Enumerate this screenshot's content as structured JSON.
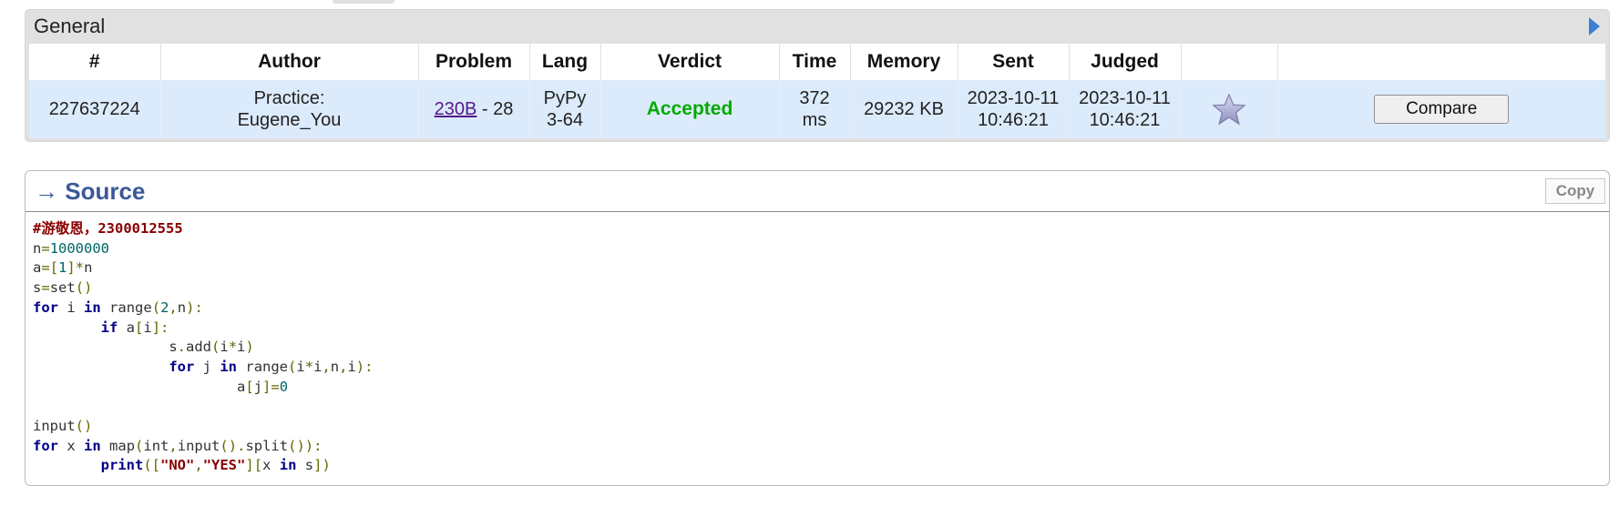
{
  "general": {
    "title": "General",
    "headers": [
      "#",
      "Author",
      "Problem",
      "Lang",
      "Verdict",
      "Time",
      "Memory",
      "Sent",
      "Judged",
      "",
      ""
    ],
    "row": {
      "id": "227637224",
      "author_line1": "Practice:",
      "author_line2": "Eugene_You",
      "problem_link": "230B",
      "problem_suffix": " - 28",
      "lang_line1": "PyPy",
      "lang_line2": "3-64",
      "verdict": "Accepted",
      "time_line1": "372",
      "time_line2": "ms",
      "memory": "29232 KB",
      "sent_date": "2023-10-11",
      "sent_time": "10:46:21",
      "judged_date": "2023-10-11",
      "judged_time": "10:46:21",
      "compare_label": "Compare"
    }
  },
  "source": {
    "header": "→ Source",
    "copy_label": "Copy",
    "lines": [
      "#游敬恩，2300012555",
      "n=1000000",
      "a=[1]*n",
      "s=set()",
      "for i in range(2,n):",
      "        if a[i]:",
      "                s.add(i*i)",
      "                for j in range(i*i,n,i):",
      "                        a[j]=0",
      "",
      "input()",
      "for x in map(int,input().split()):",
      "        print([\"NO\",\"YES\"][x in s])"
    ]
  },
  "colors": {
    "accepted": "#00aa00",
    "link": "#551a8b",
    "row_bg": "#dcebfb",
    "source_title": "#3b5998"
  }
}
